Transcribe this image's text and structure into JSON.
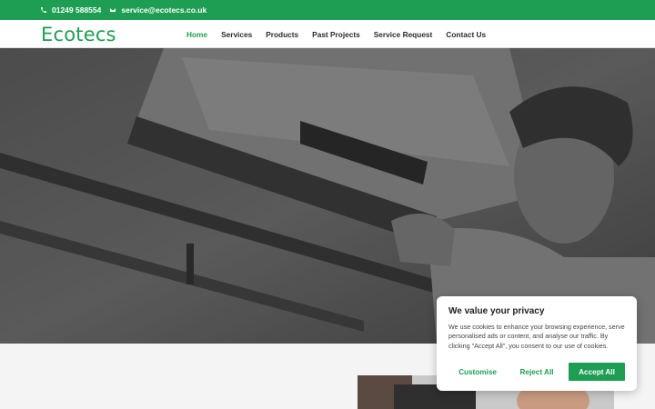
{
  "topbar": {
    "phone": "01249 588554",
    "phone_icon": "phone-icon",
    "email": "service@ecotecs.co.uk",
    "email_icon": "envelope-icon"
  },
  "brand": {
    "logo": "Ecotecs",
    "accent": "#1e9e52"
  },
  "nav": {
    "items": [
      {
        "label": "Home",
        "active": true
      },
      {
        "label": "Services"
      },
      {
        "label": "Products"
      },
      {
        "label": "Past Projects"
      },
      {
        "label": "Service Request"
      },
      {
        "label": "Contact Us"
      }
    ]
  },
  "cookie": {
    "title": "We value your privacy",
    "body": "We use cookies to enhance your browsing experience, serve personalised ads or content, and analyse our traffic. By clicking \"Accept All\", you consent to our use of cookies.",
    "customise": "Customise",
    "reject": "Reject All",
    "accept": "Accept All"
  }
}
